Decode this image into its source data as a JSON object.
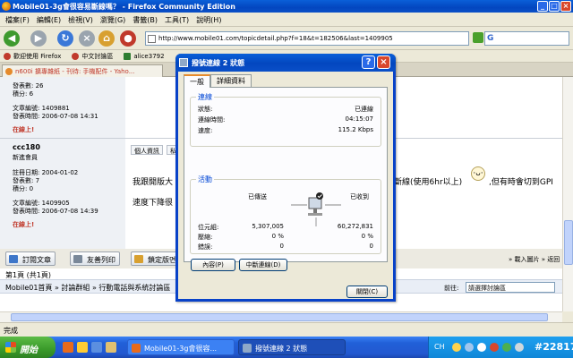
{
  "browser": {
    "title": "Mobile01-3g會很容易斷線嗎？ - Firefox Community Edition",
    "menu": [
      "檔案(F)",
      "編輯(E)",
      "檢視(V)",
      "瀏覽(G)",
      "書籤(B)",
      "工具(T)",
      "說明(H)"
    ],
    "url": "http://www.mobile01.com/topicdetail.php?f=18&t=182506&last=1409905",
    "search_placeholder": "",
    "bookmarks": [
      "歡迎使用 Firefox",
      "中文討論區",
      "alice3792"
    ],
    "tab_title": "n600i 擴專雜紙 - 刊待: 手機配件 - Yaho..."
  },
  "page": {
    "post1": {
      "reply_count": "發表數: 26",
      "points": "積分: 6",
      "article_no": "文章編號: 1409881",
      "post_time": "發表時間: 2006-07-08 14:31",
      "online": "在線上!"
    },
    "post2": {
      "username": "ccc180",
      "rank": "新進會員",
      "register": "註冊日期: 2004-01-02",
      "reply_count": "發表數: 7",
      "points": "積分: 0",
      "article_no": "文章編號: 1409905",
      "post_time": "發表時間: 2006-07-08 14:39",
      "online": "在線上!",
      "buttons": [
        "個人資訊",
        "私"
      ],
      "text_line1_left": "我跟開版大",
      "text_line1_right": "斷線(使用6hr以上)",
      "text_line1_tail": ",但有時會切到GPI",
      "text_line2": "速度下降很"
    },
    "actions": [
      "訂閱文章",
      "友善列印",
      "鎖定版면"
    ],
    "right_links": "» 載入圖片 » 返回",
    "pagination": "第1頁 (共1頁)",
    "breadcrumb": "Mobile01首頁 » 討論群組 » 行動電話與系統討論區",
    "forward_label": "前往:",
    "forward_select": "請選擇討論區"
  },
  "dialog": {
    "title": "撥號連線 2 狀態",
    "tabs": [
      "一般",
      "詳細資料"
    ],
    "connection_group": "連線",
    "status_label": "狀態:",
    "status_value": "已連線",
    "duration_label": "連線時間:",
    "duration_value": "04:15:07",
    "speed_label": "速度:",
    "speed_value": "115.2 Kbps",
    "activity_group": "活動",
    "sent_label": "已傳送",
    "received_label": "已收到",
    "bytes_label": "位元組:",
    "bytes_sent": "5,307,005",
    "bytes_received": "60,272,831",
    "compression_label": "壓縮:",
    "compression_sent": "0 %",
    "compression_received": "0 %",
    "errors_label": "錯誤:",
    "errors_sent": "0",
    "errors_received": "0",
    "properties_button": "內容(P)",
    "disconnect_button": "中斷連線(D)",
    "close_button": "關閉(C)"
  },
  "status_bar": "完成",
  "taskbar": {
    "start": "開始",
    "tasks": [
      "Mobile01-3g會很容...",
      "撥號連線 2 狀態"
    ],
    "tray_lang": "CH",
    "clock": "#22817"
  },
  "colors": {
    "xp_blue": "#0346bf",
    "tab_accent": "#e68b2c",
    "group_label": "#0046d5",
    "online_red": "#c0392b"
  }
}
